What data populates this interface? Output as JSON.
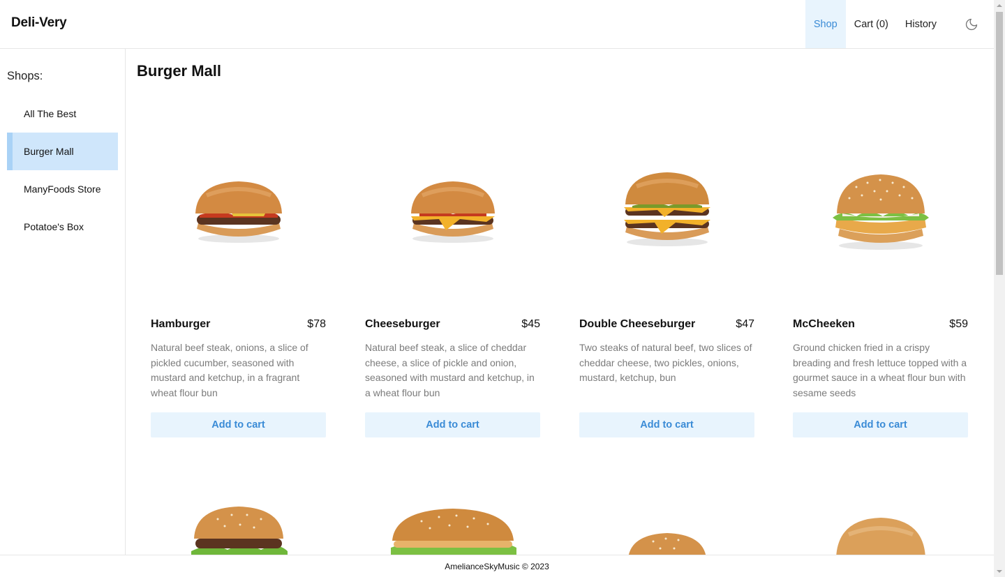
{
  "header": {
    "brand": "Deli-Very",
    "nav": [
      {
        "label": "Shop",
        "active": true
      },
      {
        "label": "Cart (0)",
        "active": false
      },
      {
        "label": "History",
        "active": false
      }
    ],
    "theme_icon": "moon-icon"
  },
  "sidebar": {
    "title": "Shops:",
    "shops": [
      {
        "label": "All The Best",
        "active": false
      },
      {
        "label": "Burger Mall",
        "active": true
      },
      {
        "label": "ManyFoods Store",
        "active": false
      },
      {
        "label": "Potatoe's Box",
        "active": false
      }
    ]
  },
  "main": {
    "title": "Burger Mall",
    "products": [
      {
        "name": "Hamburger",
        "price": "$78",
        "description": "Natural beef steak, onions, a slice of pickled cucumber, seasoned with mustard and ketchup, in a fragrant wheat flour bun",
        "button": "Add to cart",
        "image": "hamburger"
      },
      {
        "name": "Cheeseburger",
        "price": "$45",
        "description": "Natural beef steak, a slice of cheddar cheese, a slice of pickle and onion, seasoned with mustard and ketchup, in a wheat flour bun",
        "button": "Add to cart",
        "image": "cheeseburger"
      },
      {
        "name": "Double Cheeseburger",
        "price": "$47",
        "description": "Two steaks of natural beef, two slices of cheddar cheese, two pickles, onions, mustard, ketchup, bun",
        "button": "Add to cart",
        "image": "double-cheeseburger"
      },
      {
        "name": "McCheeken",
        "price": "$59",
        "description": "Ground chicken fried in a crispy breading and fresh lettuce topped with a gourmet sauce in a wheat flour bun with sesame seeds",
        "button": "Add to cart",
        "image": "chicken-burger"
      }
    ]
  },
  "footer": {
    "text": "AmelianceSkyMusic © 2023"
  },
  "colors": {
    "accent": "#3a8bd6",
    "accent_bg": "#e8f4fd",
    "active_shop_bg": "#cfe6fb",
    "description_text": "#7b7b7b"
  }
}
